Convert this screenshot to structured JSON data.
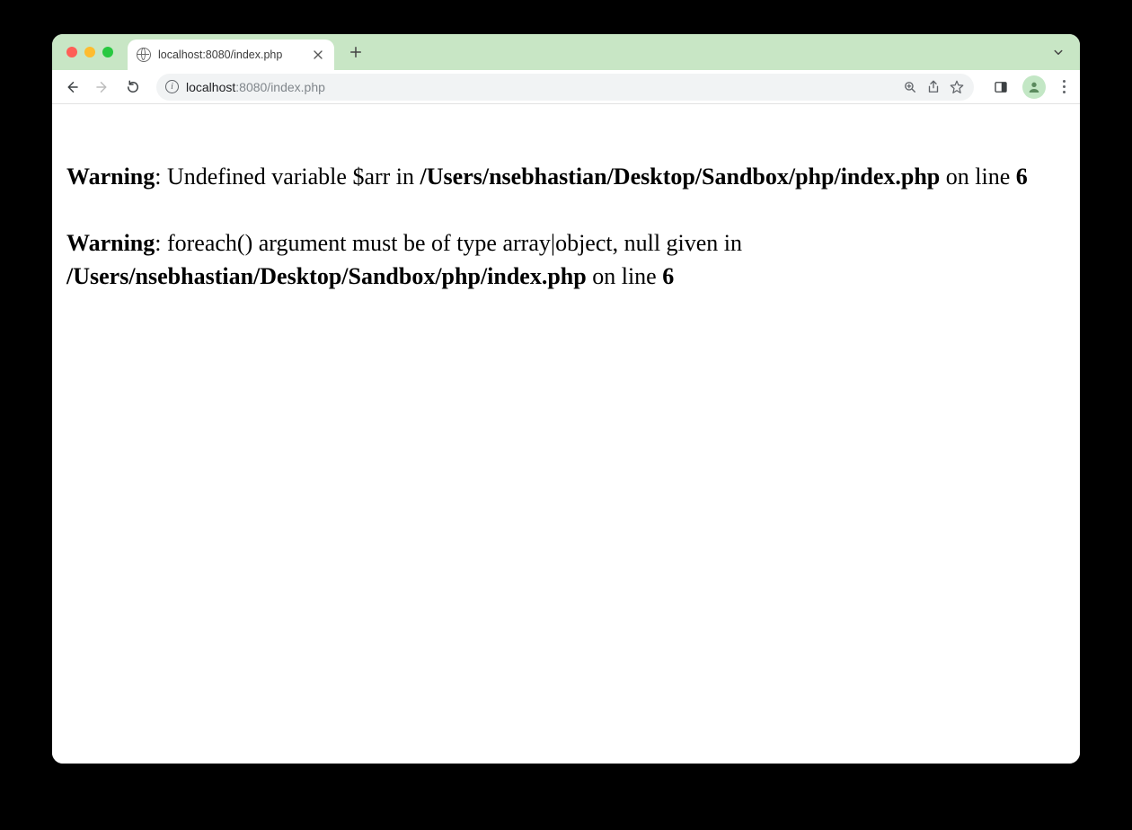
{
  "tab": {
    "title": "localhost:8080/index.php"
  },
  "address": {
    "host": "localhost",
    "rest": ":8080/index.php"
  },
  "warnings": [
    {
      "label": "Warning",
      "message_before_path": ": Undefined variable $arr in ",
      "path": "/Users/nsebhastian/Desktop/Sandbox/php/index.php",
      "on_line_text": " on line ",
      "line": "6"
    },
    {
      "label": "Warning",
      "message_before_path": ": foreach() argument must be of type array|object, null given in ",
      "path": "/Users/nsebhastian/Desktop/Sandbox/php/index.php",
      "on_line_text": " on line ",
      "line": "6"
    }
  ],
  "info_icon_glyph": "i"
}
